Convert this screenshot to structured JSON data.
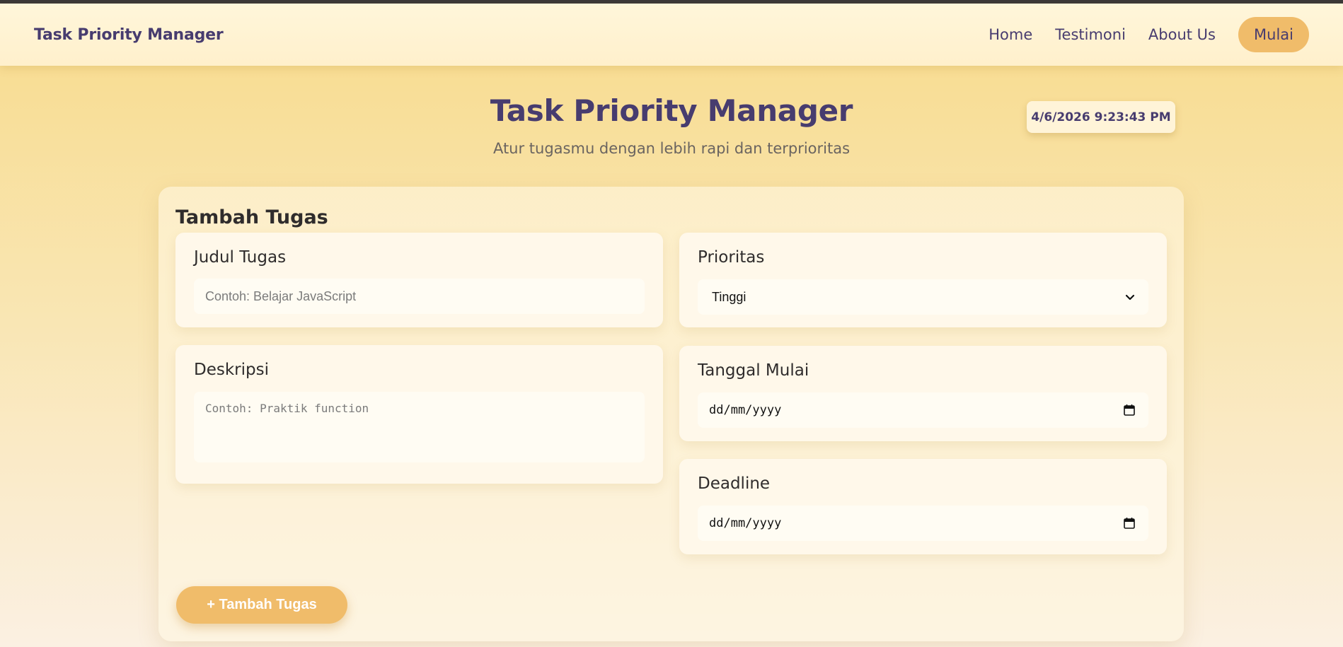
{
  "navbar": {
    "brand": "Task Priority Manager",
    "links": [
      "Home",
      "Testimoni",
      "About Us"
    ],
    "cta": "Mulai"
  },
  "hero": {
    "title": "Task Priority Manager",
    "subtitle": "Atur tugasmu dengan lebih rapi dan terprioritas",
    "clock": "4/6/2026 9:23:43 PM"
  },
  "form": {
    "title": "Tambah Tugas",
    "judul": {
      "label": "Judul Tugas",
      "placeholder": "Contoh: Belajar JavaScript",
      "value": ""
    },
    "deskripsi": {
      "label": "Deskripsi",
      "placeholder": "Contoh: Praktik function",
      "value": ""
    },
    "prioritas": {
      "label": "Prioritas",
      "selected": "Tinggi"
    },
    "tanggal_mulai": {
      "label": "Tanggal Mulai",
      "value": "dd/mm/yyyy"
    },
    "deadline": {
      "label": "Deadline",
      "value": "dd/mm/yyyy"
    },
    "submit_label": "+ Tambah Tugas"
  },
  "colors": {
    "accent": "#f0bc6a",
    "brand_text": "#473c6f",
    "top_bar": "#3a3838"
  },
  "icons": {
    "select": "chevron-down-icon",
    "date": "calendar-icon"
  }
}
